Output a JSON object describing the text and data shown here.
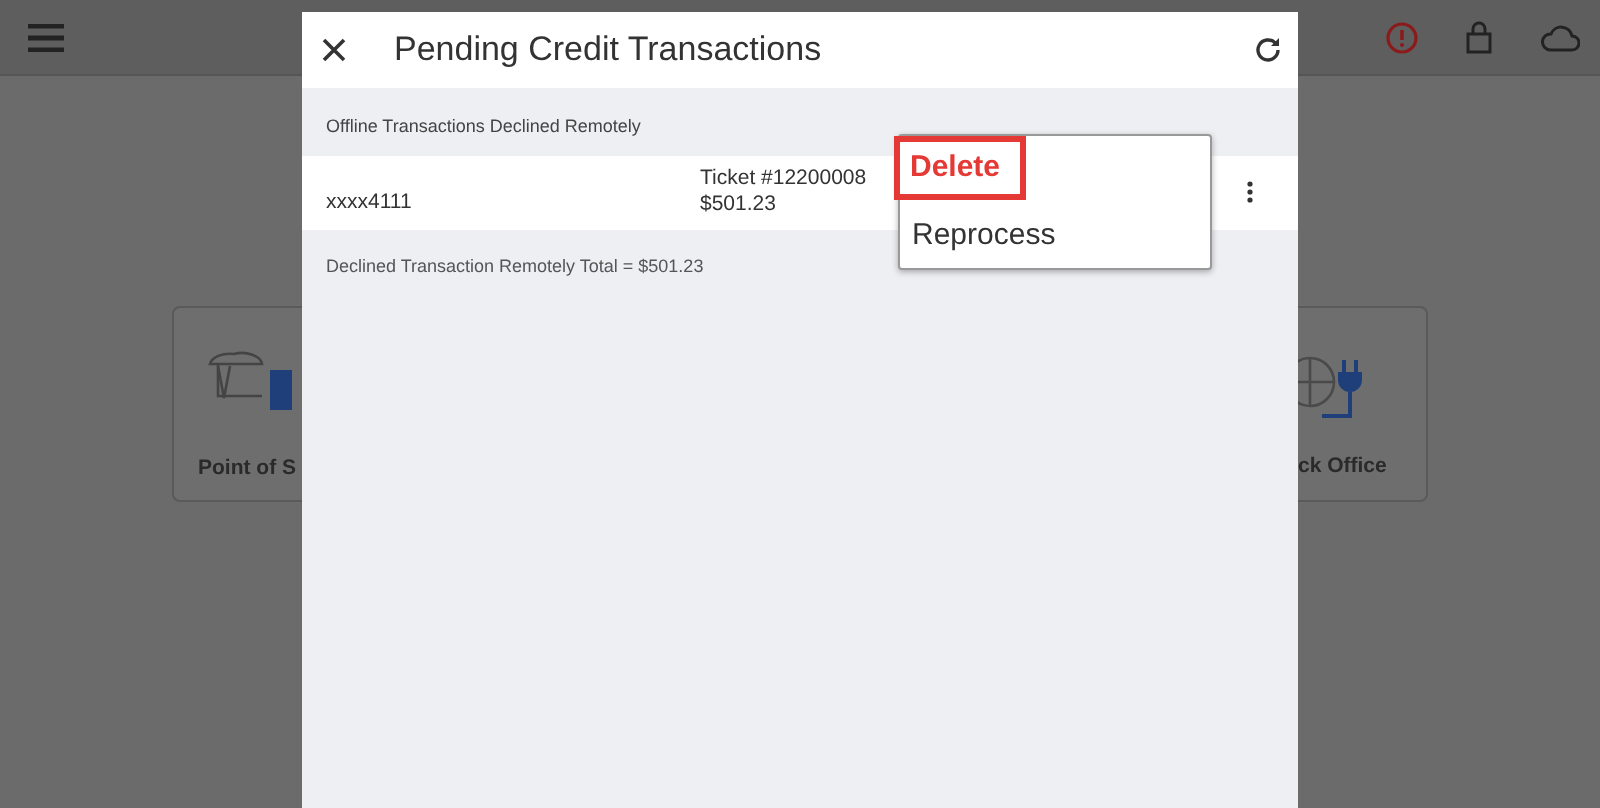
{
  "background": {
    "tiles": [
      {
        "label": "Point of S",
        "kind": "left-edge"
      },
      {
        "label": "ck Office",
        "kind": "right-edge"
      }
    ]
  },
  "dialog": {
    "title": "Pending Credit Transactions",
    "section_title": "Offline Transactions Declined Remotely",
    "transactions": [
      {
        "card": "xxxx4111",
        "ticket": "Ticket #12200008",
        "amount": "$501.23"
      }
    ],
    "total": "Declined Transaction Remotely Total = $501.23"
  },
  "menu": {
    "items": [
      {
        "label": "Delete",
        "kind": "danger",
        "selected": true
      },
      {
        "label": "Reprocess",
        "kind": "normal",
        "selected": false
      }
    ]
  }
}
